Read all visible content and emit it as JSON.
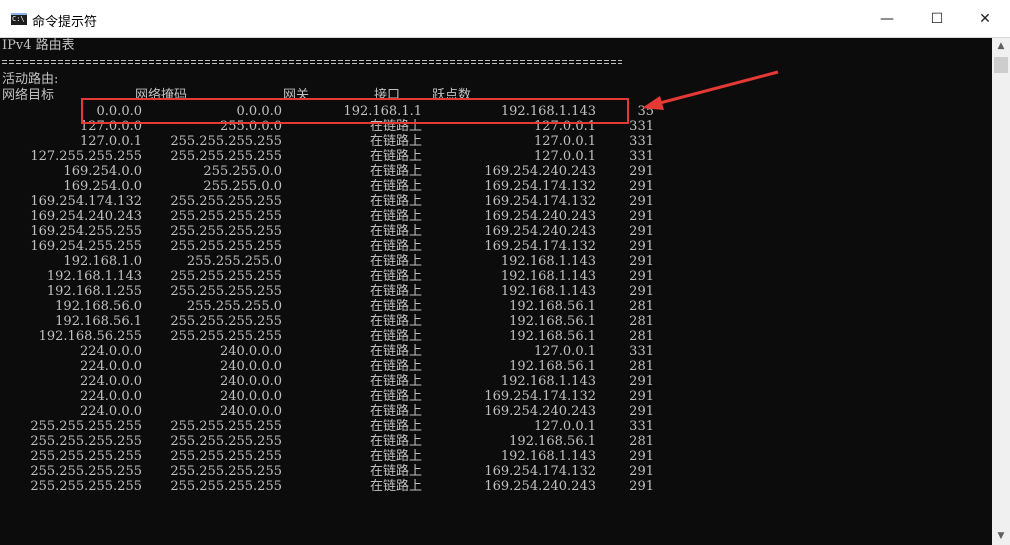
{
  "window": {
    "title": "命令提示符",
    "icon_text": "C:\\",
    "minimize_glyph": "—",
    "maximize_glyph": "☐",
    "close_glyph": "✕"
  },
  "console": {
    "heading": "IPv4 路由表",
    "section": "活动路由:",
    "columns": {
      "dest": "网络目标",
      "mask": "网络掩码",
      "gateway": "网关",
      "interface": "接口",
      "metric": "跃点数"
    },
    "routes": [
      {
        "dest": "0.0.0.0",
        "mask": "0.0.0.0",
        "gateway": "192.168.1.1",
        "interface": "192.168.1.143",
        "metric": "35"
      },
      {
        "dest": "127.0.0.0",
        "mask": "255.0.0.0",
        "gateway": "在链路上",
        "interface": "127.0.0.1",
        "metric": "331"
      },
      {
        "dest": "127.0.0.1",
        "mask": "255.255.255.255",
        "gateway": "在链路上",
        "interface": "127.0.0.1",
        "metric": "331"
      },
      {
        "dest": "127.255.255.255",
        "mask": "255.255.255.255",
        "gateway": "在链路上",
        "interface": "127.0.0.1",
        "metric": "331"
      },
      {
        "dest": "169.254.0.0",
        "mask": "255.255.0.0",
        "gateway": "在链路上",
        "interface": "169.254.240.243",
        "metric": "291"
      },
      {
        "dest": "169.254.0.0",
        "mask": "255.255.0.0",
        "gateway": "在链路上",
        "interface": "169.254.174.132",
        "metric": "291"
      },
      {
        "dest": "169.254.174.132",
        "mask": "255.255.255.255",
        "gateway": "在链路上",
        "interface": "169.254.174.132",
        "metric": "291"
      },
      {
        "dest": "169.254.240.243",
        "mask": "255.255.255.255",
        "gateway": "在链路上",
        "interface": "169.254.240.243",
        "metric": "291"
      },
      {
        "dest": "169.254.255.255",
        "mask": "255.255.255.255",
        "gateway": "在链路上",
        "interface": "169.254.240.243",
        "metric": "291"
      },
      {
        "dest": "169.254.255.255",
        "mask": "255.255.255.255",
        "gateway": "在链路上",
        "interface": "169.254.174.132",
        "metric": "291"
      },
      {
        "dest": "192.168.1.0",
        "mask": "255.255.255.0",
        "gateway": "在链路上",
        "interface": "192.168.1.143",
        "metric": "291"
      },
      {
        "dest": "192.168.1.143",
        "mask": "255.255.255.255",
        "gateway": "在链路上",
        "interface": "192.168.1.143",
        "metric": "291"
      },
      {
        "dest": "192.168.1.255",
        "mask": "255.255.255.255",
        "gateway": "在链路上",
        "interface": "192.168.1.143",
        "metric": "291"
      },
      {
        "dest": "192.168.56.0",
        "mask": "255.255.255.0",
        "gateway": "在链路上",
        "interface": "192.168.56.1",
        "metric": "281"
      },
      {
        "dest": "192.168.56.1",
        "mask": "255.255.255.255",
        "gateway": "在链路上",
        "interface": "192.168.56.1",
        "metric": "281"
      },
      {
        "dest": "192.168.56.255",
        "mask": "255.255.255.255",
        "gateway": "在链路上",
        "interface": "192.168.56.1",
        "metric": "281"
      },
      {
        "dest": "224.0.0.0",
        "mask": "240.0.0.0",
        "gateway": "在链路上",
        "interface": "127.0.0.1",
        "metric": "331"
      },
      {
        "dest": "224.0.0.0",
        "mask": "240.0.0.0",
        "gateway": "在链路上",
        "interface": "192.168.56.1",
        "metric": "281"
      },
      {
        "dest": "224.0.0.0",
        "mask": "240.0.0.0",
        "gateway": "在链路上",
        "interface": "192.168.1.143",
        "metric": "291"
      },
      {
        "dest": "224.0.0.0",
        "mask": "240.0.0.0",
        "gateway": "在链路上",
        "interface": "169.254.174.132",
        "metric": "291"
      },
      {
        "dest": "224.0.0.0",
        "mask": "240.0.0.0",
        "gateway": "在链路上",
        "interface": "169.254.240.243",
        "metric": "291"
      },
      {
        "dest": "255.255.255.255",
        "mask": "255.255.255.255",
        "gateway": "在链路上",
        "interface": "127.0.0.1",
        "metric": "331"
      },
      {
        "dest": "255.255.255.255",
        "mask": "255.255.255.255",
        "gateway": "在链路上",
        "interface": "192.168.56.1",
        "metric": "281"
      },
      {
        "dest": "255.255.255.255",
        "mask": "255.255.255.255",
        "gateway": "在链路上",
        "interface": "192.168.1.143",
        "metric": "291"
      },
      {
        "dest": "255.255.255.255",
        "mask": "255.255.255.255",
        "gateway": "在链路上",
        "interface": "169.254.174.132",
        "metric": "291"
      },
      {
        "dest": "255.255.255.255",
        "mask": "255.255.255.255",
        "gateway": "在链路上",
        "interface": "169.254.240.243",
        "metric": "291"
      }
    ]
  },
  "annotation": {
    "color": "#e53935"
  },
  "scrollbar": {
    "up_glyph": "▲",
    "down_glyph": "▼"
  }
}
